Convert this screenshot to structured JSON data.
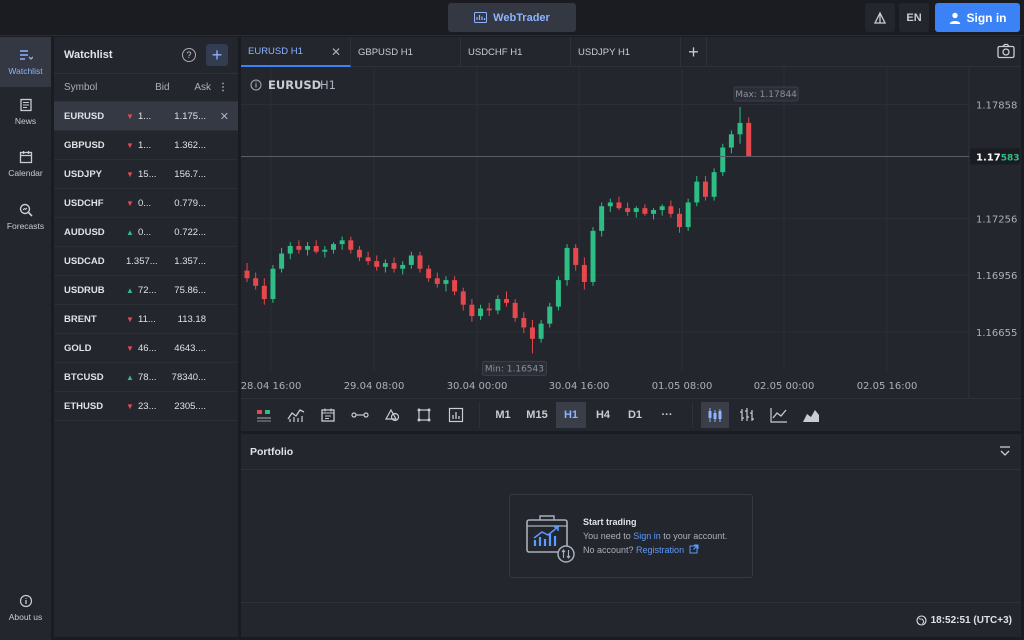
{
  "header": {
    "app_button": "WebTrader",
    "language": "EN",
    "sign_in": "Sign in"
  },
  "nav": {
    "items": [
      {
        "label": "Watchlist",
        "icon": "watchlist-icon",
        "active": true
      },
      {
        "label": "News",
        "icon": "news-icon"
      },
      {
        "label": "Calendar",
        "icon": "calendar-icon"
      },
      {
        "label": "Forecasts",
        "icon": "forecasts-icon"
      }
    ],
    "about": "About us"
  },
  "watchlist": {
    "title": "Watchlist",
    "columns": {
      "symbol": "Symbol",
      "bid": "Bid",
      "ask": "Ask"
    },
    "rows": [
      {
        "symbol": "EURUSD",
        "dir": "down",
        "bid": "1...",
        "ask": "1.175..."
      },
      {
        "symbol": "GBPUSD",
        "dir": "down",
        "bid": "1...",
        "ask": "1.362..."
      },
      {
        "symbol": "USDJPY",
        "dir": "down",
        "bid": "15...",
        "ask": "156.7..."
      },
      {
        "symbol": "USDCHF",
        "dir": "down",
        "bid": "0...",
        "ask": "0.779..."
      },
      {
        "symbol": "AUDUSD",
        "dir": "up",
        "bid": "0...",
        "ask": "0.722..."
      },
      {
        "symbol": "USDCAD",
        "dir": "none",
        "bid": "1.357...",
        "ask": "1.357..."
      },
      {
        "symbol": "USDRUB",
        "dir": "up",
        "bid": "72...",
        "ask": "75.86..."
      },
      {
        "symbol": "BRENT",
        "dir": "down",
        "bid": "11...",
        "ask": "113.18"
      },
      {
        "symbol": "GOLD",
        "dir": "down",
        "bid": "46...",
        "ask": "4643...."
      },
      {
        "symbol": "BTCUSD",
        "dir": "up",
        "bid": "78...",
        "ask": "78340..."
      },
      {
        "symbol": "ETHUSD",
        "dir": "down",
        "bid": "23...",
        "ask": "2305...."
      }
    ]
  },
  "tabs": [
    "EURUSD H1",
    "GBPUSD H1",
    "USDCHF H1",
    "USDJPY H1"
  ],
  "chart": {
    "symbol": "EURUSD",
    "timeframe": "H1",
    "max_label": "Max: 1.17844",
    "min_label": "Min: 1.16543",
    "price_tag_main": "1.17",
    "price_tag_tail": "583",
    "current_price": 1.17583
  },
  "chart_data": {
    "type": "candlestick",
    "x_ticks": [
      "28.04 16:00",
      "29.04 08:00",
      "30.04 00:00",
      "30.04 16:00",
      "01.05 08:00",
      "02.05 00:00",
      "02.05 16:00"
    ],
    "y_ticks": [
      1.17858,
      1.17256,
      1.16956,
      1.16655
    ],
    "ylim": [
      1.1645,
      1.1805
    ],
    "candles": [
      [
        1.1698,
        1.1702,
        1.1692,
        1.1694
      ],
      [
        1.1694,
        1.1697,
        1.1688,
        1.169
      ],
      [
        1.169,
        1.1694,
        1.168,
        1.1683
      ],
      [
        1.1683,
        1.1701,
        1.1681,
        1.1699
      ],
      [
        1.1699,
        1.171,
        1.1697,
        1.1707
      ],
      [
        1.1707,
        1.1713,
        1.1704,
        1.1711
      ],
      [
        1.1711,
        1.1714,
        1.1707,
        1.1709
      ],
      [
        1.1709,
        1.1713,
        1.1706,
        1.1711
      ],
      [
        1.1711,
        1.1714,
        1.1707,
        1.1708
      ],
      [
        1.1708,
        1.1711,
        1.1705,
        1.1709
      ],
      [
        1.1709,
        1.1713,
        1.1707,
        1.1712
      ],
      [
        1.1712,
        1.1716,
        1.1709,
        1.1714
      ],
      [
        1.1714,
        1.1716,
        1.1707,
        1.1709
      ],
      [
        1.1709,
        1.1711,
        1.1703,
        1.1705
      ],
      [
        1.1705,
        1.1708,
        1.1701,
        1.1703
      ],
      [
        1.1703,
        1.1706,
        1.1698,
        1.17
      ],
      [
        1.17,
        1.1704,
        1.1697,
        1.1702
      ],
      [
        1.1702,
        1.1705,
        1.1697,
        1.1699
      ],
      [
        1.1699,
        1.1703,
        1.1696,
        1.1701
      ],
      [
        1.1701,
        1.1708,
        1.1699,
        1.1706
      ],
      [
        1.1706,
        1.1708,
        1.1697,
        1.1699
      ],
      [
        1.1699,
        1.1701,
        1.1692,
        1.1694
      ],
      [
        1.1694,
        1.1697,
        1.1689,
        1.1691
      ],
      [
        1.1691,
        1.1695,
        1.1687,
        1.1693
      ],
      [
        1.1693,
        1.1695,
        1.1685,
        1.1687
      ],
      [
        1.1687,
        1.1689,
        1.1677,
        1.168
      ],
      [
        1.168,
        1.1683,
        1.1671,
        1.1674
      ],
      [
        1.1674,
        1.168,
        1.1672,
        1.1678
      ],
      [
        1.1678,
        1.1681,
        1.1674,
        1.1677
      ],
      [
        1.1677,
        1.1685,
        1.1675,
        1.1683
      ],
      [
        1.1683,
        1.1687,
        1.1679,
        1.1681
      ],
      [
        1.1681,
        1.1683,
        1.1671,
        1.1673
      ],
      [
        1.1673,
        1.1676,
        1.1665,
        1.1668
      ],
      [
        1.1668,
        1.1672,
        1.16543,
        1.1662
      ],
      [
        1.1662,
        1.1672,
        1.166,
        1.167
      ],
      [
        1.167,
        1.1681,
        1.1668,
        1.1679
      ],
      [
        1.1679,
        1.1695,
        1.1677,
        1.1693
      ],
      [
        1.1693,
        1.1712,
        1.169,
        1.171
      ],
      [
        1.171,
        1.1712,
        1.1698,
        1.1701
      ],
      [
        1.1701,
        1.1705,
        1.1688,
        1.1692
      ],
      [
        1.1692,
        1.1721,
        1.169,
        1.1719
      ],
      [
        1.1719,
        1.1734,
        1.1716,
        1.1732
      ],
      [
        1.1732,
        1.1736,
        1.1729,
        1.1734
      ],
      [
        1.1734,
        1.1737,
        1.173,
        1.1731
      ],
      [
        1.1731,
        1.1734,
        1.1727,
        1.1729
      ],
      [
        1.1729,
        1.1732,
        1.1726,
        1.1731
      ],
      [
        1.1731,
        1.1733,
        1.1727,
        1.1728
      ],
      [
        1.1728,
        1.1731,
        1.1725,
        1.173
      ],
      [
        1.173,
        1.1733,
        1.1727,
        1.1732
      ],
      [
        1.1732,
        1.1735,
        1.1726,
        1.1728
      ],
      [
        1.1728,
        1.1731,
        1.1718,
        1.1721
      ],
      [
        1.1721,
        1.1736,
        1.1719,
        1.1734
      ],
      [
        1.1734,
        1.1748,
        1.1732,
        1.1745
      ],
      [
        1.1745,
        1.1748,
        1.1735,
        1.1737
      ],
      [
        1.1737,
        1.1752,
        1.1735,
        1.175
      ],
      [
        1.175,
        1.1765,
        1.1748,
        1.1763
      ],
      [
        1.1763,
        1.1772,
        1.176,
        1.177
      ],
      [
        1.177,
        1.17844,
        1.1765,
        1.1776
      ],
      [
        1.1776,
        1.1779,
        1.1765,
        1.17583
      ]
    ]
  },
  "toolbar": {
    "timeframes": [
      "M1",
      "M15",
      "H1",
      "H4",
      "D1"
    ],
    "active_timeframe": "H1",
    "more": "···"
  },
  "portfolio": {
    "title": "Portfolio",
    "card_title": "Start trading",
    "line1_pre": "You need to ",
    "line1_link": "Sign in",
    "line1_post": " to your account.",
    "line2_pre": "No account? ",
    "line2_link": "Registration"
  },
  "footer": {
    "time": "18:52:51 (UTC+3)"
  },
  "colors": {
    "accent": "#3b82f6",
    "up": "#2ebd85",
    "down": "#e5484d"
  }
}
